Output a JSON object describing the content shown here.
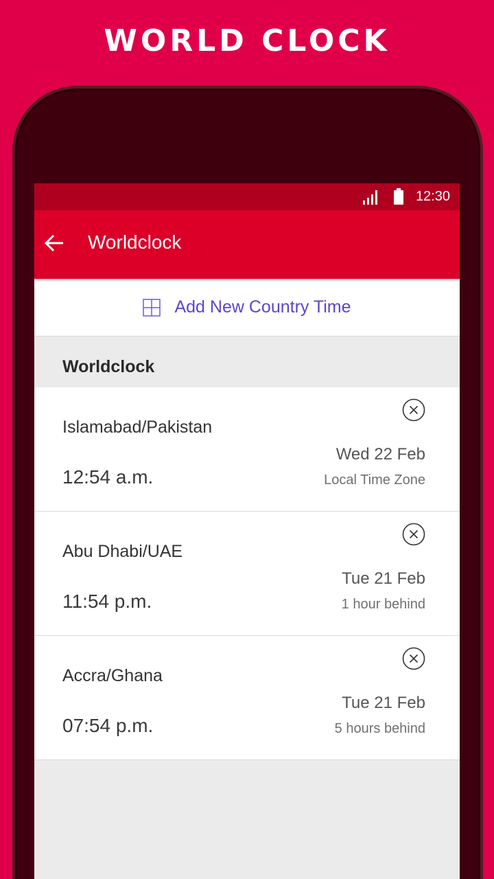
{
  "promo": {
    "title": "WORLD CLOCK"
  },
  "status_bar": {
    "time": "12:30"
  },
  "app_bar": {
    "title": "Worldclock"
  },
  "add_button": {
    "label": "Add New Country Time"
  },
  "section": {
    "title": "Worldclock"
  },
  "clocks": [
    {
      "city": "Islamabad/Pakistan",
      "time": "12:54 a.m.",
      "date": "Wed 22 Feb",
      "offset": "Local Time Zone"
    },
    {
      "city": "Abu Dhabi/UAE",
      "time": "11:54 p.m.",
      "date": "Tue 21 Feb",
      "offset": "1 hour behind"
    },
    {
      "city": "Accra/Ghana",
      "time": "07:54 p.m.",
      "date": "Tue 21 Feb",
      "offset": "5 hours behind"
    }
  ],
  "colors": {
    "background": "#e0004a",
    "status_bar": "#b00020",
    "app_bar": "#dc0028",
    "accent": "#5c45cf"
  },
  "icons": {
    "back": "arrow-left-icon",
    "add": "plus-box-icon",
    "remove": "close-circle-icon",
    "signal": "signal-icon",
    "battery": "battery-icon"
  }
}
